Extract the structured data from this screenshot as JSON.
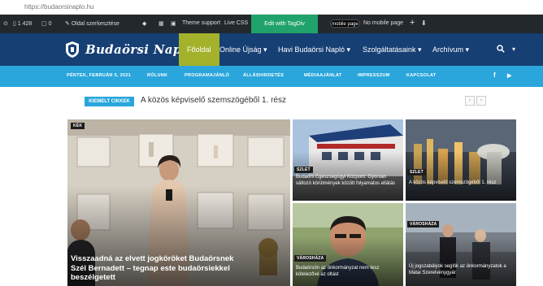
{
  "browser": {
    "url": "https://budaorsinaplo.hu"
  },
  "admin_bar": {
    "count_1": "1 428",
    "count_2": "0",
    "customize": "Oldal szerkesztése",
    "theme_support": "Theme support",
    "live_css": "Live CSS",
    "edit_button": "Edit with TagDiv Composer",
    "mobile_toggle": "mobile page",
    "no_mobile": "No mobile page",
    "plus": "+"
  },
  "header": {
    "logo_text": "Budaörsi Napló",
    "nav": [
      {
        "label": "Főoldal"
      },
      {
        "label": "Online Újság"
      },
      {
        "label": "Havi Budaörsi Napló"
      },
      {
        "label": "Szolgáltatásaink"
      },
      {
        "label": "Archívum"
      }
    ]
  },
  "subnav": {
    "date": "PÉNTEK, FEBRUÁR 5, 2021",
    "items": [
      "RÓLUNK",
      "PROGRAMAJÁNLÓ",
      "ÁLLÁSHIRDETÉS",
      "MÉDIAAJÁNLAT",
      "IMPRESSZUM",
      "KAPCSOLAT"
    ]
  },
  "breaking": {
    "tag": "KIEMELT CIKKEK",
    "headline": "A közös képviselő szemszögéből 1. rész"
  },
  "tiles": {
    "main": {
      "category": "KÉK",
      "title": "Visszaadná az elvett jogköröket Budaörsnek Szél Bernadett – tegnap este budaörsiekkel beszélgetett"
    },
    "top_mid": {
      "category": "SZLET",
      "title": "Budaörs Egészségügyi Központ: Gyorsan változó körülmények között folyamatos ellátás"
    },
    "top_right": {
      "category": "SZLET",
      "title": "A közös képviselő szemszögéből 1. rész"
    },
    "bot_mid": {
      "category": "VÁROSHÁZA",
      "title": "Budaörsön az önkormányzat nem tesz kötelezővé az oltást"
    },
    "bot_right": {
      "category": "VÁROSHÁZA",
      "title": "Új jogszabályok segítik az önkormányzatok a Mátai Szerelvénygyár"
    }
  },
  "colors": {
    "admin_bg": "#23282d",
    "header_bg": "#163f74",
    "active_nav": "#a3b12b",
    "subnav_bg": "#2aa6dc",
    "edit_green": "#20a36a"
  }
}
